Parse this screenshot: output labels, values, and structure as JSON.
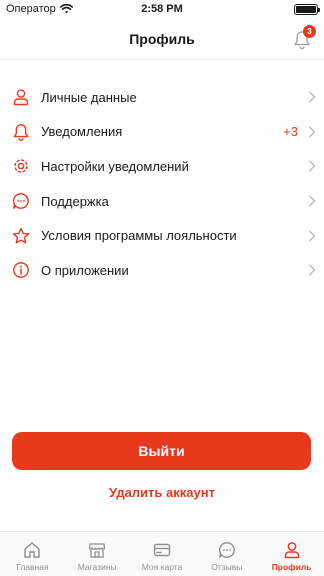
{
  "status_bar": {
    "carrier": "Оператор",
    "time": "2:58 PM",
    "battery_level": 1.0
  },
  "header": {
    "title": "Профиль",
    "notification_badge": "3"
  },
  "menu": [
    {
      "label": "Личные данные",
      "icon": "person-icon"
    },
    {
      "label": "Уведомления",
      "icon": "bell-icon",
      "count": "+3"
    },
    {
      "label": "Настройки уведомлений",
      "icon": "gear-icon"
    },
    {
      "label": "Поддержка",
      "icon": "chat-bubble-icon"
    },
    {
      "label": "Условия программы лояльности",
      "icon": "star-icon"
    },
    {
      "label": "О приложении",
      "icon": "info-icon"
    }
  ],
  "actions": {
    "logout_label": "Выйти",
    "delete_account_label": "Удалить аккаунт"
  },
  "tabbar": {
    "items": [
      {
        "label": "Главная",
        "icon": "home-icon"
      },
      {
        "label": "Магазины",
        "icon": "store-icon"
      },
      {
        "label": "Моя карта",
        "icon": "card-icon"
      },
      {
        "label": "Отзывы",
        "icon": "chat-dots-icon"
      },
      {
        "label": "Профиль",
        "icon": "person-icon",
        "active": true
      }
    ]
  },
  "colors": {
    "accent": "#e8391c",
    "inactive": "#8e8e93",
    "text": "#1a1a1a"
  }
}
